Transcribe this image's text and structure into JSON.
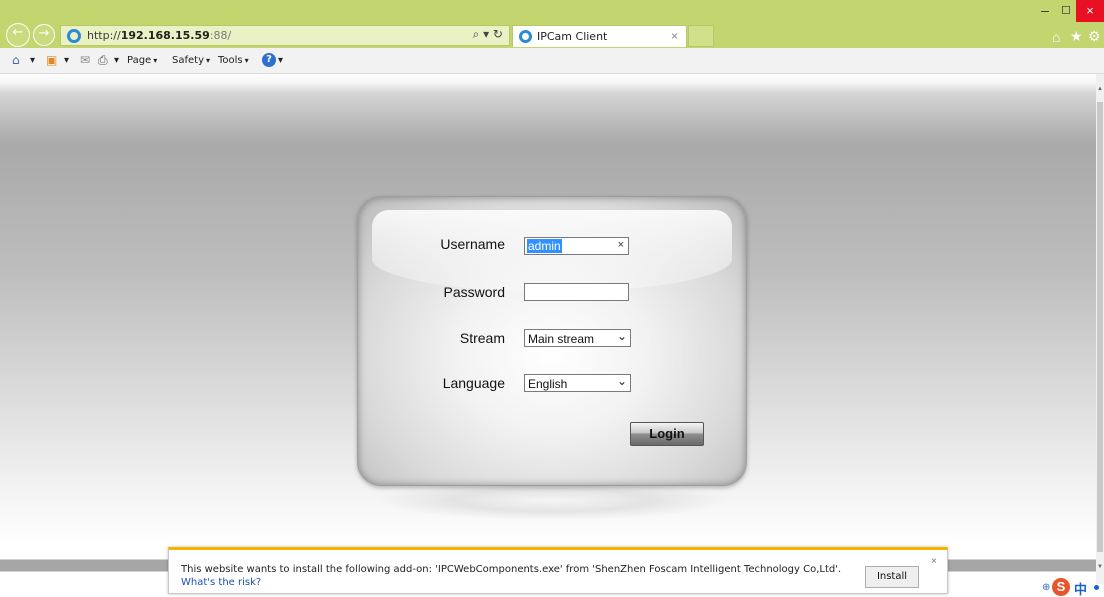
{
  "browser": {
    "url_prefix": "http://",
    "url_host": "192.168.15.59",
    "url_port": ":88/",
    "search_refresh": "⌕ ▾ ↻",
    "tab_title": "IPCam Client",
    "tab_close": "×",
    "window_buttons": {
      "minimize": "–",
      "maximize": "◻",
      "close": "×"
    },
    "right_icons": {
      "home": "⌂",
      "favorites": "★",
      "tools": "⚙"
    }
  },
  "command_bar": {
    "page_label": "Page",
    "safety_label": "Safety",
    "tools_label": "Tools",
    "help_label": "?",
    "caret": "▾"
  },
  "login": {
    "username_label": "Username",
    "username_value": "admin",
    "clear_glyph": "×",
    "password_label": "Password",
    "password_value": "",
    "stream_label": "Stream",
    "stream_value": "Main stream",
    "language_label": "Language",
    "language_value": "English",
    "dropdown_glyph": "⌄",
    "login_button": "Login"
  },
  "notification": {
    "message": "This website wants to install the following add-on: 'IPCWebComponents.exe' from 'ShenZhen Foscam Intelligent Technology Co,Ltd'.",
    "risk_link": "What's the risk?",
    "install_button": "Install",
    "close_glyph": "×"
  },
  "tray": {
    "sogou_glyph": "S",
    "ime_glyph": "中"
  },
  "icon_names": [
    "back-icon",
    "forward-icon",
    "ie-icon",
    "home-icon",
    "favorites-icon",
    "gear-icon",
    "feeds-icon",
    "mail-icon",
    "print-icon",
    "help-icon",
    "dropdown-arrow-icon",
    "zoom-icon",
    "sogou-icon"
  ],
  "colors": {
    "titlebar": "#c2d56e",
    "close_button": "#e81123",
    "notification_accent": "#f2b400",
    "selection": "#3390ff",
    "link": "#1a4fb8"
  }
}
